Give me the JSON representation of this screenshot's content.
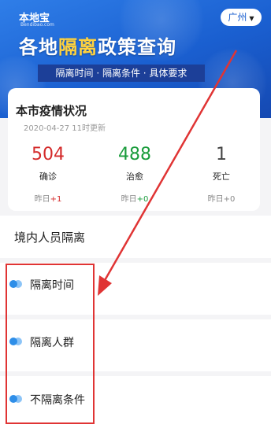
{
  "header": {
    "logo": "本地宝",
    "logo_sub": "Bendibao.com",
    "city": "广州",
    "title_prefix": "各地",
    "title_highlight": "隔离",
    "title_suffix": "政策查询",
    "subtitle": "隔离时间 · 隔离条件 · 具体要求"
  },
  "status_card": {
    "title": "本市疫情状况",
    "updated": "2020-04-27 11时更新",
    "stats": [
      {
        "value": "504",
        "label": "确诊",
        "delta_prefix": "昨日",
        "delta": "+1",
        "color": "#d42a2a"
      },
      {
        "value": "488",
        "label": "治愈",
        "delta_prefix": "昨日",
        "delta": "+0",
        "color": "#1a9c3c"
      },
      {
        "value": "1",
        "label": "死亡",
        "delta_prefix": "昨日",
        "delta": "+0",
        "color": "#444444"
      }
    ]
  },
  "section": {
    "title": "境内人员隔离",
    "items": [
      {
        "label": "隔离时间"
      },
      {
        "label": "隔离人群"
      },
      {
        "label": "不隔离条件"
      }
    ]
  },
  "colors": {
    "brand_blue": "#1a5fd0",
    "title_highlight": "#ffd23f",
    "annotation_red": "#e03434"
  }
}
